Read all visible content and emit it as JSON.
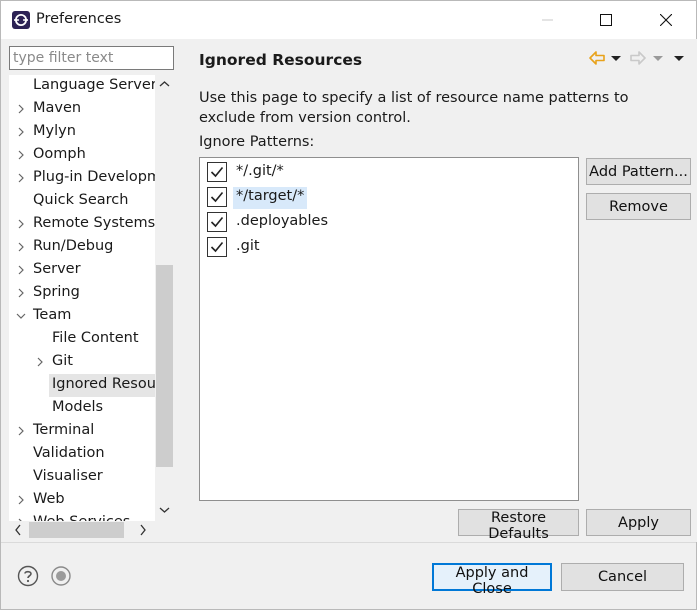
{
  "window": {
    "title": "Preferences"
  },
  "filter": {
    "placeholder": "type filter text",
    "value": ""
  },
  "tree": {
    "items": [
      {
        "label": "Language Servers",
        "expander": "none",
        "indent": 1
      },
      {
        "label": "Maven",
        "expander": "collapsed",
        "indent": 1
      },
      {
        "label": "Mylyn",
        "expander": "collapsed",
        "indent": 1
      },
      {
        "label": "Oomph",
        "expander": "collapsed",
        "indent": 1
      },
      {
        "label": "Plug-in Development",
        "expander": "collapsed",
        "indent": 1
      },
      {
        "label": "Quick Search",
        "expander": "none",
        "indent": 1
      },
      {
        "label": "Remote Systems",
        "expander": "collapsed",
        "indent": 1
      },
      {
        "label": "Run/Debug",
        "expander": "collapsed",
        "indent": 1
      },
      {
        "label": "Server",
        "expander": "collapsed",
        "indent": 1
      },
      {
        "label": "Spring",
        "expander": "collapsed",
        "indent": 1
      },
      {
        "label": "Team",
        "expander": "expanded",
        "indent": 1
      },
      {
        "label": "File Content",
        "expander": "none",
        "indent": 2
      },
      {
        "label": "Git",
        "expander": "collapsed",
        "indent": 2
      },
      {
        "label": "Ignored Resources",
        "expander": "none",
        "indent": 2,
        "selected": true
      },
      {
        "label": "Models",
        "expander": "none",
        "indent": 2
      },
      {
        "label": "Terminal",
        "expander": "collapsed",
        "indent": 1
      },
      {
        "label": "Validation",
        "expander": "none",
        "indent": 1
      },
      {
        "label": "Visualiser",
        "expander": "none",
        "indent": 1
      },
      {
        "label": "Web",
        "expander": "collapsed",
        "indent": 1
      },
      {
        "label": "Web Services",
        "expander": "collapsed",
        "indent": 1
      }
    ]
  },
  "page": {
    "title": "Ignored Resources",
    "description": "Use this page to specify a list of resource name patterns to exclude from version control.",
    "patterns_label": "Ignore Patterns:",
    "patterns": [
      {
        "text": "*/.git/*",
        "checked": true,
        "highlight": false
      },
      {
        "text": "*/target/*",
        "checked": true,
        "highlight": true
      },
      {
        "text": ".deployables",
        "checked": true,
        "highlight": false
      },
      {
        "text": ".git",
        "checked": true,
        "highlight": false
      }
    ],
    "add_pattern_label": "Add Pattern...",
    "remove_label": "Remove",
    "restore_defaults_label": "Restore Defaults",
    "apply_label": "Apply"
  },
  "footer": {
    "apply_close_label": "Apply and Close",
    "cancel_label": "Cancel"
  },
  "colors": {
    "accent": "#0078d7",
    "nav_arrow": "#e8a21a",
    "selection": "#d8e9fa"
  }
}
